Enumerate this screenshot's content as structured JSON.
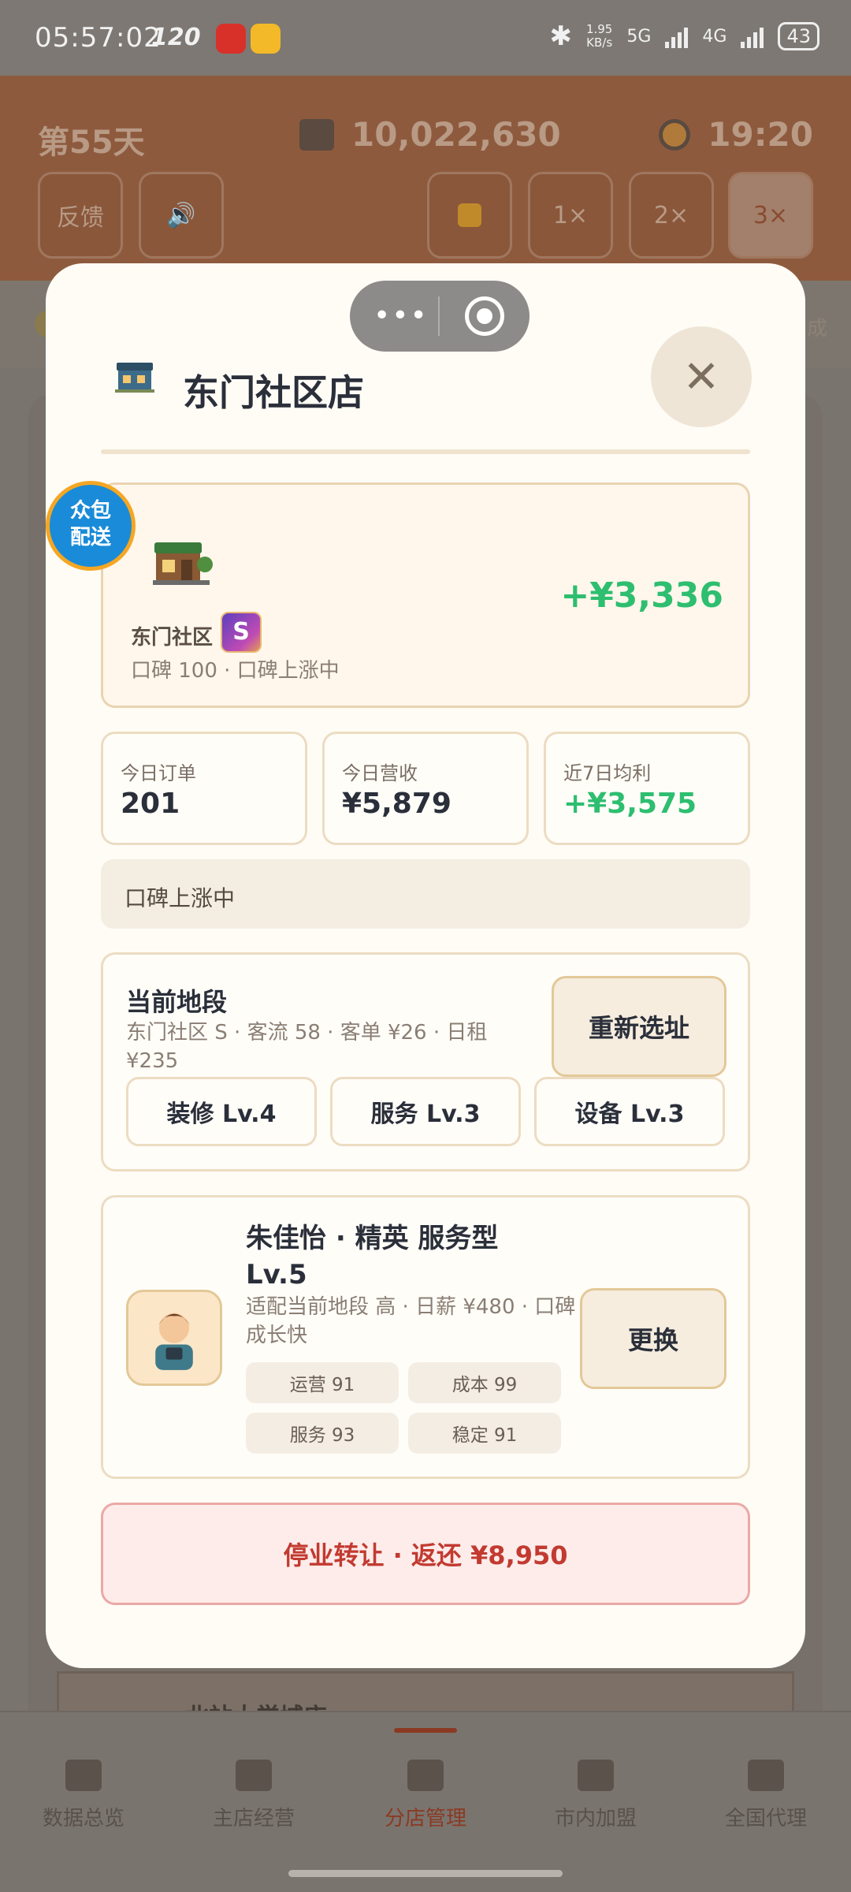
{
  "status_bar": {
    "time": "05:57:02",
    "refresh_rate": "120",
    "net_speed_value": "1.95",
    "net_speed_unit": "KB/s",
    "net_5g": "5G",
    "net_4g": "4G",
    "battery": "43"
  },
  "header": {
    "day": "第55天",
    "money": "10,022,630",
    "clock": "19:20",
    "feedback_label": "反馈",
    "speed_1x": "1×",
    "speed_2x": "2×",
    "speed_3x": "3×",
    "edge_label": "成"
  },
  "background": {
    "next_shop_name": "北站大学城店"
  },
  "modal": {
    "title": "东门社区店",
    "badge_crowd_line1": "众包",
    "badge_crowd_line2": "配送",
    "hero": {
      "area_name": "东门社区",
      "grade": "S",
      "reputation": "口碑 100 · 口碑上涨中",
      "profit": "+¥3,336"
    },
    "stats": [
      {
        "label": "今日订单",
        "value": "201"
      },
      {
        "label": "今日营收",
        "value": "¥5,879"
      },
      {
        "label": "近7日均利",
        "value": "+¥3,575"
      }
    ],
    "trend": "口碑上涨中",
    "location": {
      "title": "当前地段",
      "desc": "东门社区 S · 客流 58 · 客单 ¥26 · 日租 ¥235",
      "relocate_label": "重新选址",
      "levels": [
        "装修 Lv.4",
        "服务 Lv.3",
        "设备 Lv.3"
      ]
    },
    "manager": {
      "name": "朱佳怡 · 精英 服务型 Lv.5",
      "desc": "适配当前地段 高 · 日薪 ¥480 · 口碑成长快",
      "skills": [
        "运营 91",
        "成本 99",
        "服务 93",
        "稳定 91"
      ],
      "swap_label": "更换"
    },
    "close_shop_label": "停业转让 · 返还 ¥8,950"
  },
  "bottom_nav": {
    "tabs": [
      "数据总览",
      "主店经营",
      "分店管理",
      "市内加盟",
      "全国代理"
    ],
    "active_index": 2
  },
  "colors": {
    "profit_green": "#2ebe70",
    "danger_red": "#c23a30",
    "crowd_badge_blue": "#1a8bd8"
  }
}
